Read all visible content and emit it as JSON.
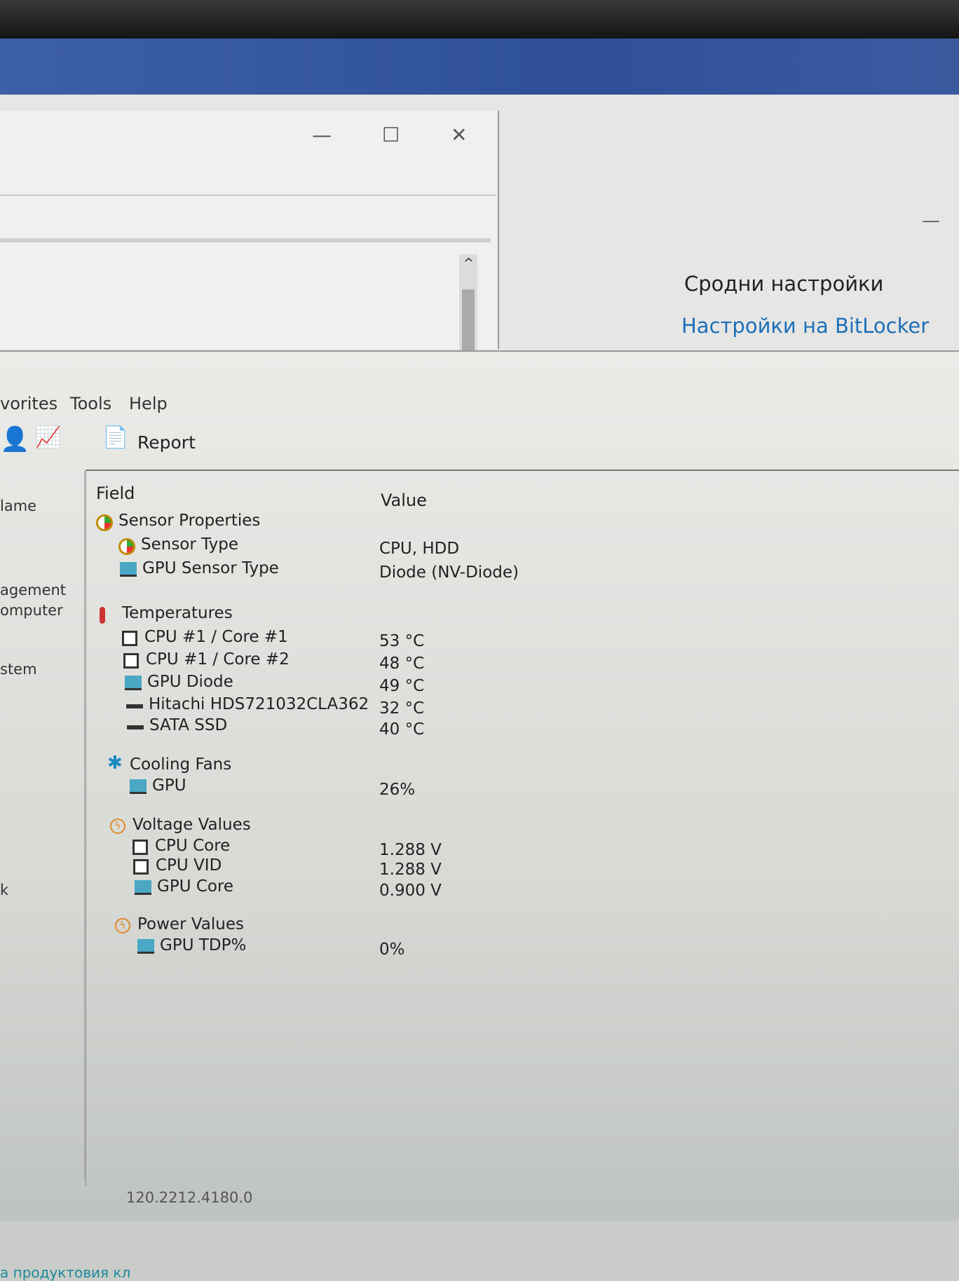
{
  "background_window": {
    "minimize": "—",
    "maximize": "☐",
    "close": "✕",
    "scroll_up": "^"
  },
  "settings_panel": {
    "heading": "Сродни настройки",
    "link": "Настройки на BitLocker",
    "minimize": "—"
  },
  "menu": [
    "vorites",
    "Tools",
    "Help"
  ],
  "toolbar": {
    "report_label": "Report",
    "icons": [
      "user-icon",
      "chart-icon",
      "report-icon"
    ]
  },
  "sidebar": [
    "lame",
    "agement",
    "omputer",
    "stem",
    "k"
  ],
  "table": {
    "headers": {
      "field": "Field",
      "value": "Value"
    },
    "rows": [
      {
        "icon": "gauge",
        "level": 0,
        "field": "Sensor Properties",
        "value": ""
      },
      {
        "icon": "gauge",
        "level": 1,
        "field": "Sensor Type",
        "value": "CPU, HDD"
      },
      {
        "icon": "monitor",
        "level": 1,
        "field": "GPU Sensor Type",
        "value": "Diode  (NV-Diode)"
      },
      {
        "icon": "thermometer",
        "level": 0,
        "field": "Temperatures",
        "value": ""
      },
      {
        "icon": "chip",
        "level": 1,
        "field": "CPU #1 / Core #1",
        "value": "53 °C"
      },
      {
        "icon": "chip",
        "level": 1,
        "field": "CPU #1 / Core #2",
        "value": "48 °C"
      },
      {
        "icon": "monitor",
        "level": 1,
        "field": "GPU Diode",
        "value": "49 °C"
      },
      {
        "icon": "disk",
        "level": 1,
        "field": "Hitachi HDS721032CLA362",
        "value": "32 °C"
      },
      {
        "icon": "disk",
        "level": 1,
        "field": "SATA SSD",
        "value": "40 °C"
      },
      {
        "icon": "fan",
        "level": 0,
        "field": "Cooling Fans",
        "value": ""
      },
      {
        "icon": "monitor",
        "level": 1,
        "field": "GPU",
        "value": "26%"
      },
      {
        "icon": "bolt",
        "level": 0,
        "field": "Voltage Values",
        "value": ""
      },
      {
        "icon": "chip",
        "level": 1,
        "field": "CPU Core",
        "value": "1.288 V"
      },
      {
        "icon": "chip",
        "level": 1,
        "field": "CPU VID",
        "value": "1.288 V"
      },
      {
        "icon": "monitor",
        "level": 1,
        "field": "GPU Core",
        "value": "0.900 V"
      },
      {
        "icon": "bolt",
        "level": 0,
        "field": "Power Values",
        "value": ""
      },
      {
        "icon": "monitor",
        "level": 1,
        "field": "GPU TDP%",
        "value": "0%"
      }
    ]
  },
  "status_bar": {
    "version": "120.2212.4180.0"
  },
  "footer_text": "а продуктовия кл"
}
